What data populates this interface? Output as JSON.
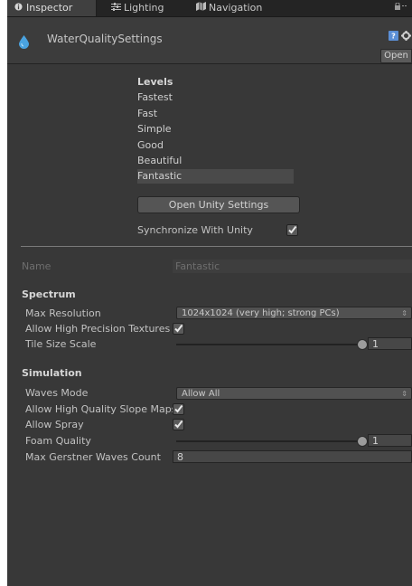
{
  "tabs": [
    {
      "label": "Inspector",
      "icon": "info-icon"
    },
    {
      "label": "Lighting",
      "icon": "lighting-icon"
    },
    {
      "label": "Navigation",
      "icon": "navigation-icon"
    }
  ],
  "header": {
    "asset_name": "WaterQualitySettings",
    "open_label": "Open"
  },
  "levels": {
    "title": "Levels",
    "items": [
      "Fastest",
      "Fast",
      "Simple",
      "Good",
      "Beautiful",
      "Fantastic"
    ],
    "selected_index": 5,
    "open_settings_label": "Open Unity Settings",
    "sync_label": "Synchronize With Unity",
    "sync_checked": true
  },
  "name_field": {
    "label": "Name",
    "value": "Fantastic"
  },
  "spectrum": {
    "title": "Spectrum",
    "max_resolution_label": "Max Resolution",
    "max_resolution_value": "1024x1024 (very high; strong PCs)",
    "high_precision_label": "Allow High Precision Textures",
    "high_precision_checked": true,
    "tile_size_label": "Tile Size Scale",
    "tile_size_value": "1"
  },
  "simulation": {
    "title": "Simulation",
    "waves_mode_label": "Waves Mode",
    "waves_mode_value": "Allow All",
    "slope_maps_label": "Allow High Quality Slope Maps",
    "slope_maps_checked": true,
    "spray_label": "Allow Spray",
    "spray_checked": true,
    "foam_quality_label": "Foam Quality",
    "foam_quality_value": "1",
    "gerstner_label": "Max Gerstner Waves Count",
    "gerstner_value": "8"
  },
  "colors": {
    "panel_bg": "#383838",
    "tab_bg": "#242424",
    "water_drop": "#4aa3e0"
  }
}
